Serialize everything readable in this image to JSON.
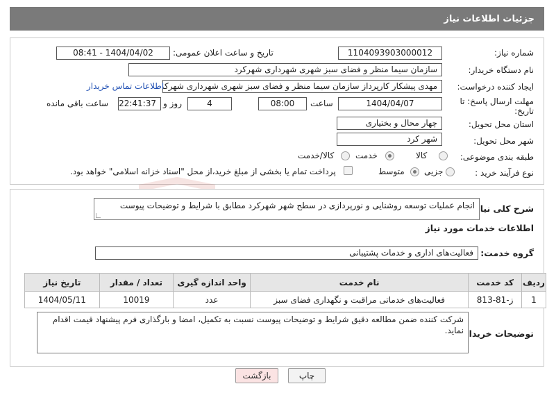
{
  "header": {
    "title": "جزئیات اطلاعات نیاز"
  },
  "fields": {
    "need_number": {
      "label": "شماره نیاز:",
      "value": "1104093903000012"
    },
    "announce_datetime": {
      "label": "تاریخ و ساعت اعلان عمومی:",
      "value": "1404/04/02 - 08:41"
    },
    "buyer_org": {
      "label": "نام دستگاه خریدار:",
      "value": "سازمان سیما منظر و فضای سبز شهری شهرداری شهرکرد"
    },
    "requester": {
      "label": "ایجاد کننده درخواست:",
      "value": "مهدی پیشکار کارپرداز سازمان سیما منظر و فضای سبز شهری شهرداری شهرکرد",
      "link": "اطلاعات تماس خریدار"
    },
    "deadline": {
      "label_line1": "مهلت ارسال پاسخ: تا",
      "label_line2": "تاریخ:",
      "date": "1404/04/07",
      "time_label": "ساعت",
      "time": "08:00",
      "days": "4",
      "days_label": "روز و",
      "remaining": "22:41:37",
      "remaining_label": "ساعت باقی مانده"
    },
    "province": {
      "label": "استان محل تحویل:",
      "value": "چهار محال و بختیاری"
    },
    "city": {
      "label": "شهر محل تحویل:",
      "value": "شهر کرد"
    },
    "category": {
      "label": "طبقه بندی موضوعی:",
      "options": [
        "کالا",
        "خدمت",
        "کالا/خدمت"
      ],
      "selected": "خدمت"
    },
    "process": {
      "label": "نوع فرآیند خرید :",
      "options": [
        "جزیی",
        "متوسط"
      ],
      "selected": "متوسط",
      "payment_note": "پرداخت تمام یا بخشی از مبلغ خرید،از محل \"اسناد خزانه اسلامی\" خواهد بود."
    }
  },
  "description": {
    "label": "شرح کلی نیاز:",
    "value": "انجام عملیات توسعه روشنایی و نورپردازی در سطح شهر شهرکرد مطابق با شرایط و توضیحات پیوست"
  },
  "services_info": {
    "title": "اطلاعات خدمات مورد نیاز"
  },
  "service_group": {
    "label": "گروه خدمت:",
    "value": "فعالیت‌های اداری و خدمات پشتیبانی"
  },
  "table": {
    "headers": [
      "ردیف",
      "کد خدمت",
      "نام خدمت",
      "واحد اندازه گیری",
      "تعداد / مقدار",
      "تاریخ نیاز"
    ],
    "rows": [
      [
        "1",
        "ز-81-813",
        "فعالیت‌های خدماتی مراقبت و نگهداری فضای سبز",
        "عدد",
        "10019",
        "1404/05/11"
      ]
    ]
  },
  "buyer_notes": {
    "label": "توضیحات خریدار:",
    "value": "شرکت کننده ضمن مطالعه دقیق شرایط و توضیحات پیوست نسبت به تکمیل، امضا و بارگذاری فرم پیشنهاد قیمت اقدام نماید."
  },
  "buttons": {
    "print": "چاپ",
    "back": "بازگشت"
  },
  "watermark": {
    "text": "AriaTender.neT"
  },
  "colors": {
    "header_bg": "#7a7a7a",
    "link": "#1f4fb3",
    "back_button": "#fbe3e3",
    "watermark": "#c0392b"
  }
}
